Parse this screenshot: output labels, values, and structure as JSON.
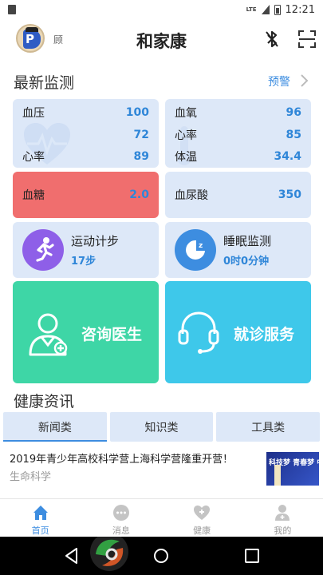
{
  "status_bar": {
    "network": "LTE",
    "time": "12:21"
  },
  "header": {
    "user_name": "顾",
    "title": "和家康"
  },
  "latest": {
    "title": "最新监测",
    "alert_label": "预警"
  },
  "vitals": {
    "bp_label": "血压",
    "bp_high": "100",
    "bp_low": "72",
    "hr_label": "心率",
    "hr_value": "89",
    "oxygen_label": "血氧",
    "oxygen_value": "96",
    "hr2_label": "心率",
    "hr2_value": "85",
    "temp_label": "体温",
    "temp_value": "34.4",
    "sugar_label": "血糖",
    "sugar_value": "2.0",
    "uric_label": "血尿酸",
    "uric_value": "350"
  },
  "features": {
    "steps_title": "运动计步",
    "steps_value": "17步",
    "sleep_title": "睡眠监测",
    "sleep_value": "0时0分钟",
    "consult_label": "咨询医生",
    "service_label": "就诊服务"
  },
  "news": {
    "title": "健康资讯",
    "tabs": [
      "新闻类",
      "知识类",
      "工具类"
    ],
    "item_title": "2019年青少年高校科学营上海科学营隆重开营！",
    "item_category": "生命科学",
    "thumb_text": "科技梦 青春梦 中"
  },
  "bottom_nav": [
    "首页",
    "消息",
    "健康",
    "我的"
  ],
  "colors": {
    "accent": "#3d8de0",
    "card_bg": "#dde8f8",
    "sugar_alert": "#f06e6e",
    "consult_card": "#3ed6a6",
    "service_card": "#3ec8ea",
    "steps_icon": "#8e5fe8",
    "sleep_icon": "#3d8de0"
  }
}
